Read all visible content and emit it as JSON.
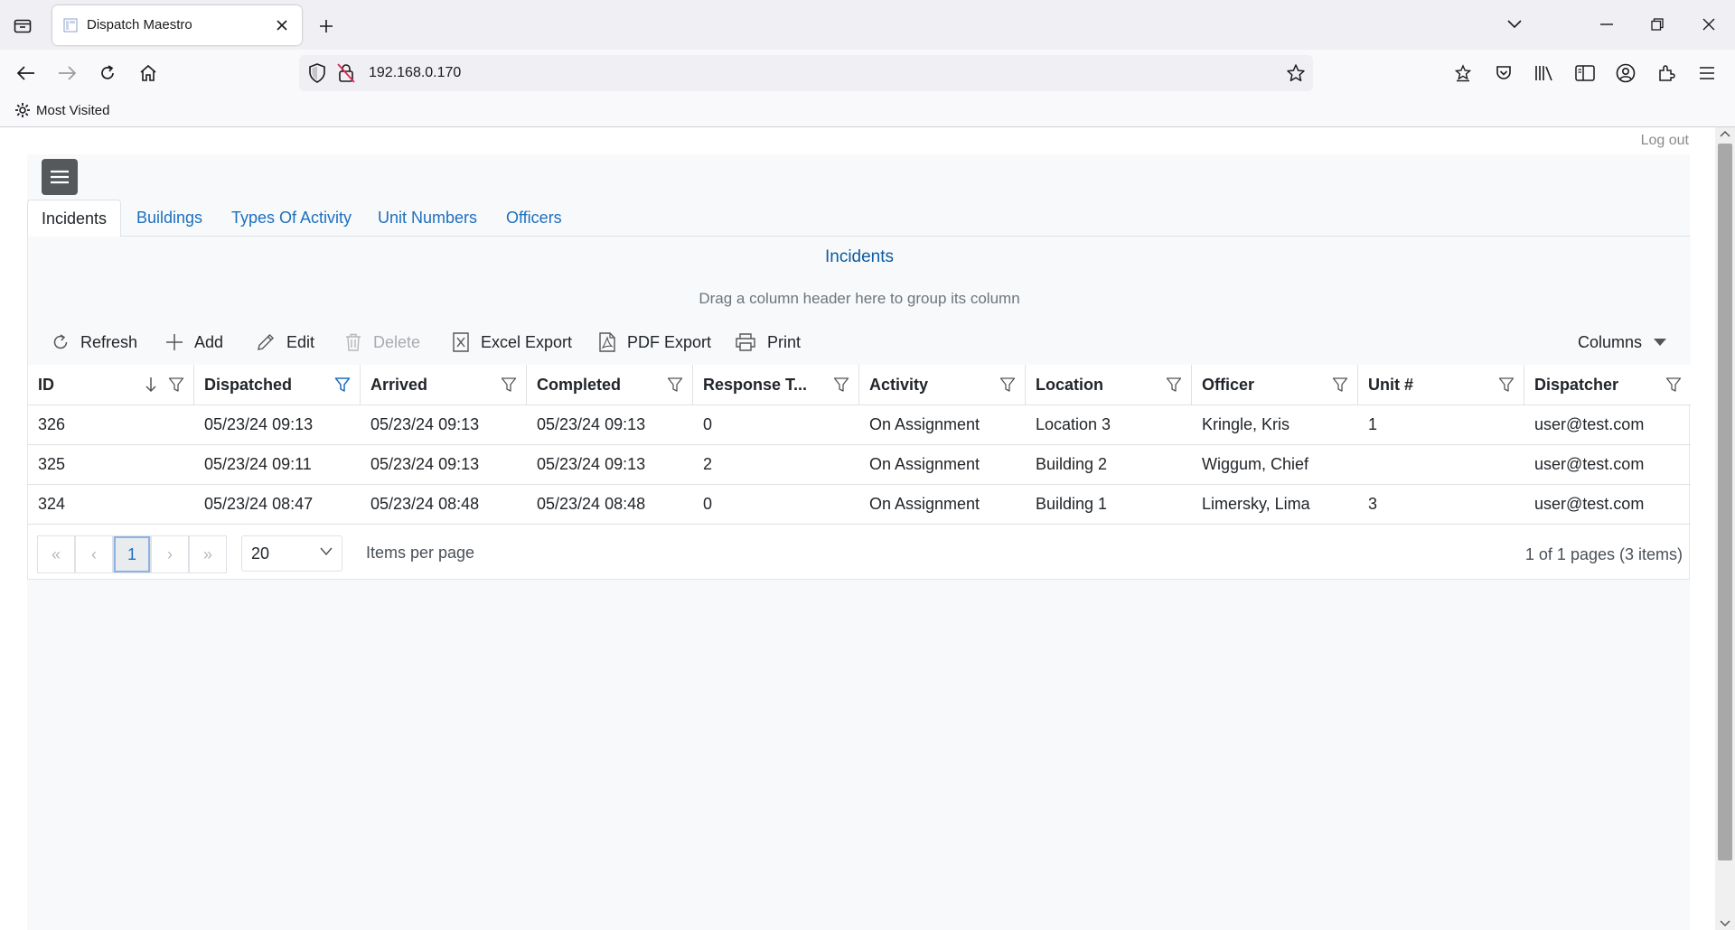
{
  "browser": {
    "tab_title": "Dispatch Maestro",
    "url": "192.168.0.170",
    "bookmarks": {
      "most_visited": "Most Visited"
    }
  },
  "page": {
    "logout": "Log out",
    "nav_tabs": [
      {
        "label": "Incidents",
        "active": true
      },
      {
        "label": "Buildings"
      },
      {
        "label": "Types Of Activity"
      },
      {
        "label": "Unit Numbers"
      },
      {
        "label": "Officers"
      }
    ],
    "grid": {
      "title": "Incidents",
      "group_hint": "Drag a column header here to group its column",
      "toolbar": {
        "refresh": "Refresh",
        "add": "Add",
        "edit": "Edit",
        "delete": "Delete",
        "excel": "Excel Export",
        "pdf": "PDF Export",
        "print": "Print",
        "columns": "Columns"
      },
      "columns": [
        "ID",
        "Dispatched",
        "Arrived",
        "Completed",
        "Response T...",
        "Activity",
        "Location",
        "Officer",
        "Unit #",
        "Dispatcher"
      ],
      "rows": [
        [
          "326",
          "05/23/24 09:13",
          "05/23/24 09:13",
          "05/23/24 09:13",
          "0",
          "On Assignment",
          "Location 3",
          "Kringle, Kris",
          "1",
          "user@test.com"
        ],
        [
          "325",
          "05/23/24 09:11",
          "05/23/24 09:13",
          "05/23/24 09:13",
          "2",
          "On Assignment",
          "Building 2",
          "Wiggum, Chief",
          "",
          "user@test.com"
        ],
        [
          "324",
          "05/23/24 08:47",
          "05/23/24 08:48",
          "05/23/24 08:48",
          "0",
          "On Assignment",
          "Building 1",
          "Limersky, Lima",
          "3",
          "user@test.com"
        ]
      ],
      "pager": {
        "first": "«",
        "prev": "‹",
        "current": "1",
        "next": "›",
        "last": "»",
        "page_size": "20",
        "items_per_page": "Items per page",
        "info": "1 of 1 pages (3 items)"
      }
    }
  },
  "colors": {
    "link": "#1d6fbf",
    "title": "#0e5ba1",
    "filter_active": "#1d6fbf"
  }
}
